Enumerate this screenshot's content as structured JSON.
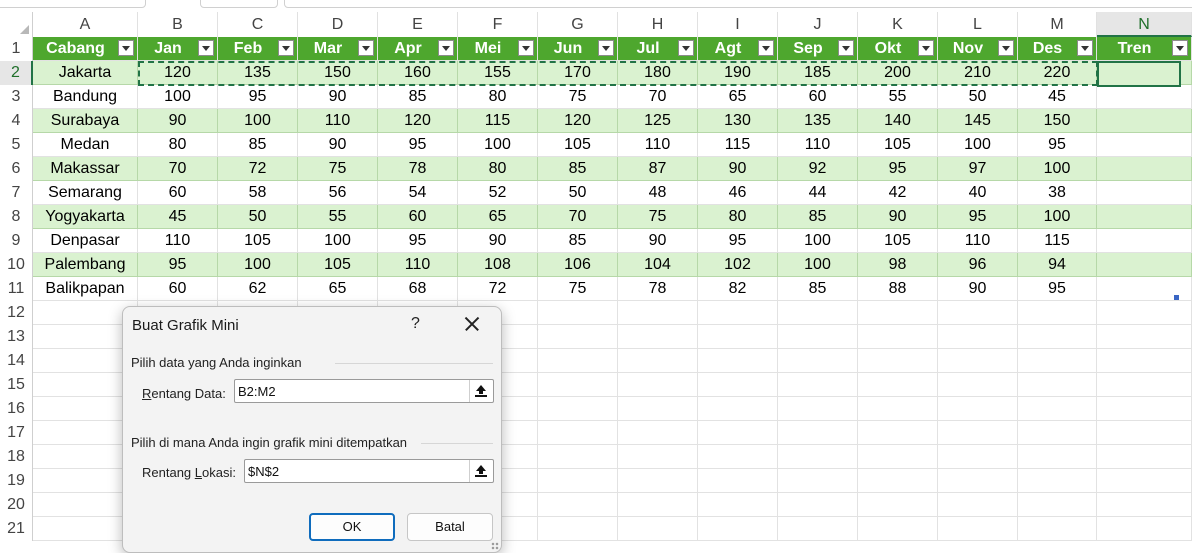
{
  "columns": [
    "A",
    "B",
    "C",
    "D",
    "E",
    "F",
    "G",
    "H",
    "I",
    "J",
    "K",
    "L",
    "M",
    "N"
  ],
  "rows": [
    "1",
    "2",
    "3",
    "4",
    "5",
    "6",
    "7",
    "8",
    "9",
    "10",
    "11",
    "12",
    "13",
    "14",
    "15",
    "16",
    "17",
    "18",
    "19",
    "20",
    "21"
  ],
  "header": [
    "Cabang",
    "Jan",
    "Feb",
    "Mar",
    "Apr",
    "Mei",
    "Jun",
    "Jul",
    "Agt",
    "Sep",
    "Okt",
    "Nov",
    "Des",
    "Tren"
  ],
  "data": [
    {
      "city": "Jakarta",
      "values": [
        "120",
        "135",
        "150",
        "160",
        "155",
        "170",
        "180",
        "190",
        "185",
        "200",
        "210",
        "220"
      ]
    },
    {
      "city": "Bandung",
      "values": [
        "100",
        "95",
        "90",
        "85",
        "80",
        "75",
        "70",
        "65",
        "60",
        "55",
        "50",
        "45"
      ]
    },
    {
      "city": "Surabaya",
      "values": [
        "90",
        "100",
        "110",
        "120",
        "115",
        "120",
        "125",
        "130",
        "135",
        "140",
        "145",
        "150"
      ]
    },
    {
      "city": "Medan",
      "values": [
        "80",
        "85",
        "90",
        "95",
        "100",
        "105",
        "110",
        "115",
        "110",
        "105",
        "100",
        "95"
      ]
    },
    {
      "city": "Makassar",
      "values": [
        "70",
        "72",
        "75",
        "78",
        "80",
        "85",
        "87",
        "90",
        "92",
        "95",
        "97",
        "100"
      ]
    },
    {
      "city": "Semarang",
      "values": [
        "60",
        "58",
        "56",
        "54",
        "52",
        "50",
        "48",
        "46",
        "44",
        "42",
        "40",
        "38"
      ]
    },
    {
      "city": "Yogyakarta",
      "values": [
        "45",
        "50",
        "55",
        "60",
        "65",
        "70",
        "75",
        "80",
        "85",
        "90",
        "95",
        "100"
      ]
    },
    {
      "city": "Denpasar",
      "values": [
        "110",
        "105",
        "100",
        "95",
        "90",
        "85",
        "90",
        "95",
        "100",
        "105",
        "110",
        "115"
      ]
    },
    {
      "city": "Palembang",
      "values": [
        "95",
        "100",
        "105",
        "110",
        "108",
        "106",
        "104",
        "102",
        "100",
        "98",
        "96",
        "94"
      ]
    },
    {
      "city": "Balikpapan",
      "values": [
        "60",
        "62",
        "65",
        "68",
        "72",
        "75",
        "78",
        "82",
        "85",
        "88",
        "90",
        "95"
      ]
    }
  ],
  "dialog": {
    "title": "Buat Grafik Mini",
    "help": "?",
    "section1": "Pilih data yang Anda inginkan",
    "data_range_label_pre": "R",
    "data_range_label_post": "entang Data:",
    "data_range_value": "B2:M2",
    "section2": "Pilih di mana Anda ingin grafik mini ditempatkan",
    "loc_range_label_pre": "Rentang ",
    "loc_range_label_u": "L",
    "loc_range_label_post": "okasi:",
    "loc_range_value": "$N$2",
    "ok_label": "OK",
    "cancel_label": "Batal"
  },
  "colors": {
    "header_green": "#4ea72e",
    "band_green": "#daf2d0",
    "selection_green": "#217346",
    "ok_border": "#0f6cbd"
  }
}
